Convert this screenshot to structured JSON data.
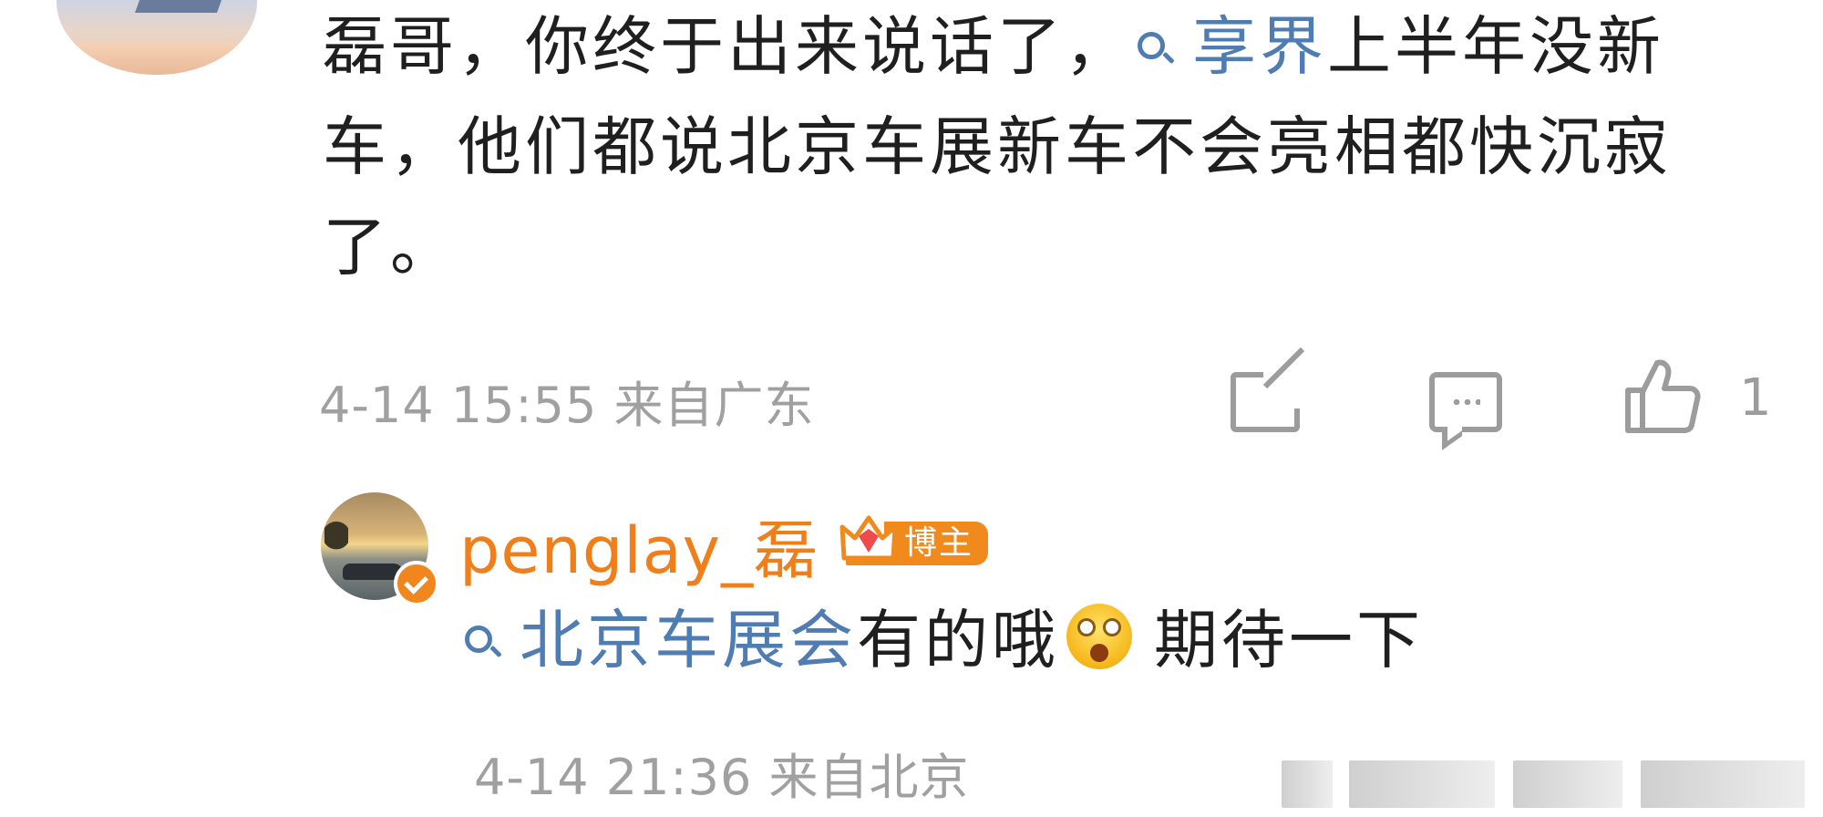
{
  "comment": {
    "text_part1": "磊哥，你终于出来说话了，",
    "topic": "享界",
    "text_part2": "上半年没新车，他们都说北京车展新车不会亮相都快沉寂了。",
    "timestamp": "4-14 15:55",
    "location": "来自广东",
    "like_count": "1"
  },
  "reply": {
    "username": "penglay_磊",
    "badge": "博主",
    "topic": "北京车展会",
    "text_part1": "有的哦",
    "text_part2": "期待一下",
    "emoji": "cute-surprised-emoji",
    "timestamp": "4-14 21:36",
    "location": "来自北京"
  },
  "colors": {
    "link": "#4f7cb3",
    "username": "#ef7f1a",
    "badge": "#f08a1d",
    "meta": "#a0a0a0",
    "text": "#1f1f1f"
  },
  "icons": {
    "share": "share-icon",
    "comment": "comment-icon",
    "like": "thumbs-up-icon",
    "search": "search-icon",
    "verified": "verified-check-icon",
    "crown": "crown-icon"
  }
}
